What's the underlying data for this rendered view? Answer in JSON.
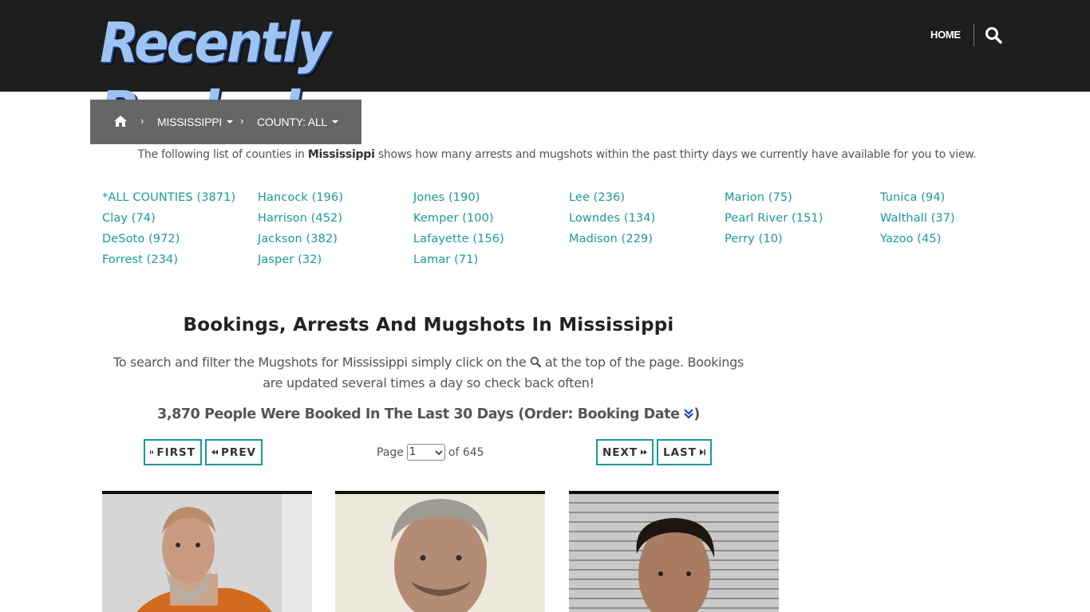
{
  "header": {
    "logo_text": "Recently Booked",
    "nav_home": "HOME",
    "search_icon": "search-icon"
  },
  "breadcrumb": {
    "home_icon": "home-icon",
    "state": "MISSISSIPPI",
    "county": "COUNTY: ALL"
  },
  "intro": {
    "before": "The following list of counties in ",
    "state": "Mississippi",
    "after": " shows how many arrests and mugshots within the past thirty days we currently have available for you to view."
  },
  "counties": [
    [
      "*ALL COUNTIES (3871)",
      "Clay (74)",
      "DeSoto (972)",
      "Forrest (234)"
    ],
    [
      "Hancock (196)",
      "Harrison (452)",
      "Jackson (382)",
      "Jasper (32)"
    ],
    [
      "Jones (190)",
      "Kemper (100)",
      "Lafayette (156)",
      "Lamar (71)"
    ],
    [
      "Lee (236)",
      "Lowndes (134)",
      "Madison (229)"
    ],
    [
      "Marion (75)",
      "Pearl River (151)",
      "Perry (10)"
    ],
    [
      "Tunica (94)",
      "Walthall (37)",
      "Yazoo (45)"
    ]
  ],
  "main": {
    "title": "Bookings, Arrests And Mugshots In Mississippi",
    "instructions_before": "To search and filter the Mugshots for Mississippi simply click on the ",
    "instructions_after": " at the top of the page. Bookings are updated several times a day so check back often!",
    "count_line_before": "3,870 People Were Booked In The Last 30 Days (Order: Booking Date ",
    "count_line_after": ")"
  },
  "pager": {
    "first": "FIRST",
    "prev": "PREV",
    "next": "NEXT",
    "last": "LAST",
    "page_label": "Page",
    "page_value": "1",
    "of_label": "of 645"
  },
  "colors": {
    "accent": "#1a9a96",
    "header_bg": "#1e1e1e",
    "breadcrumb_bg": "#666666"
  }
}
